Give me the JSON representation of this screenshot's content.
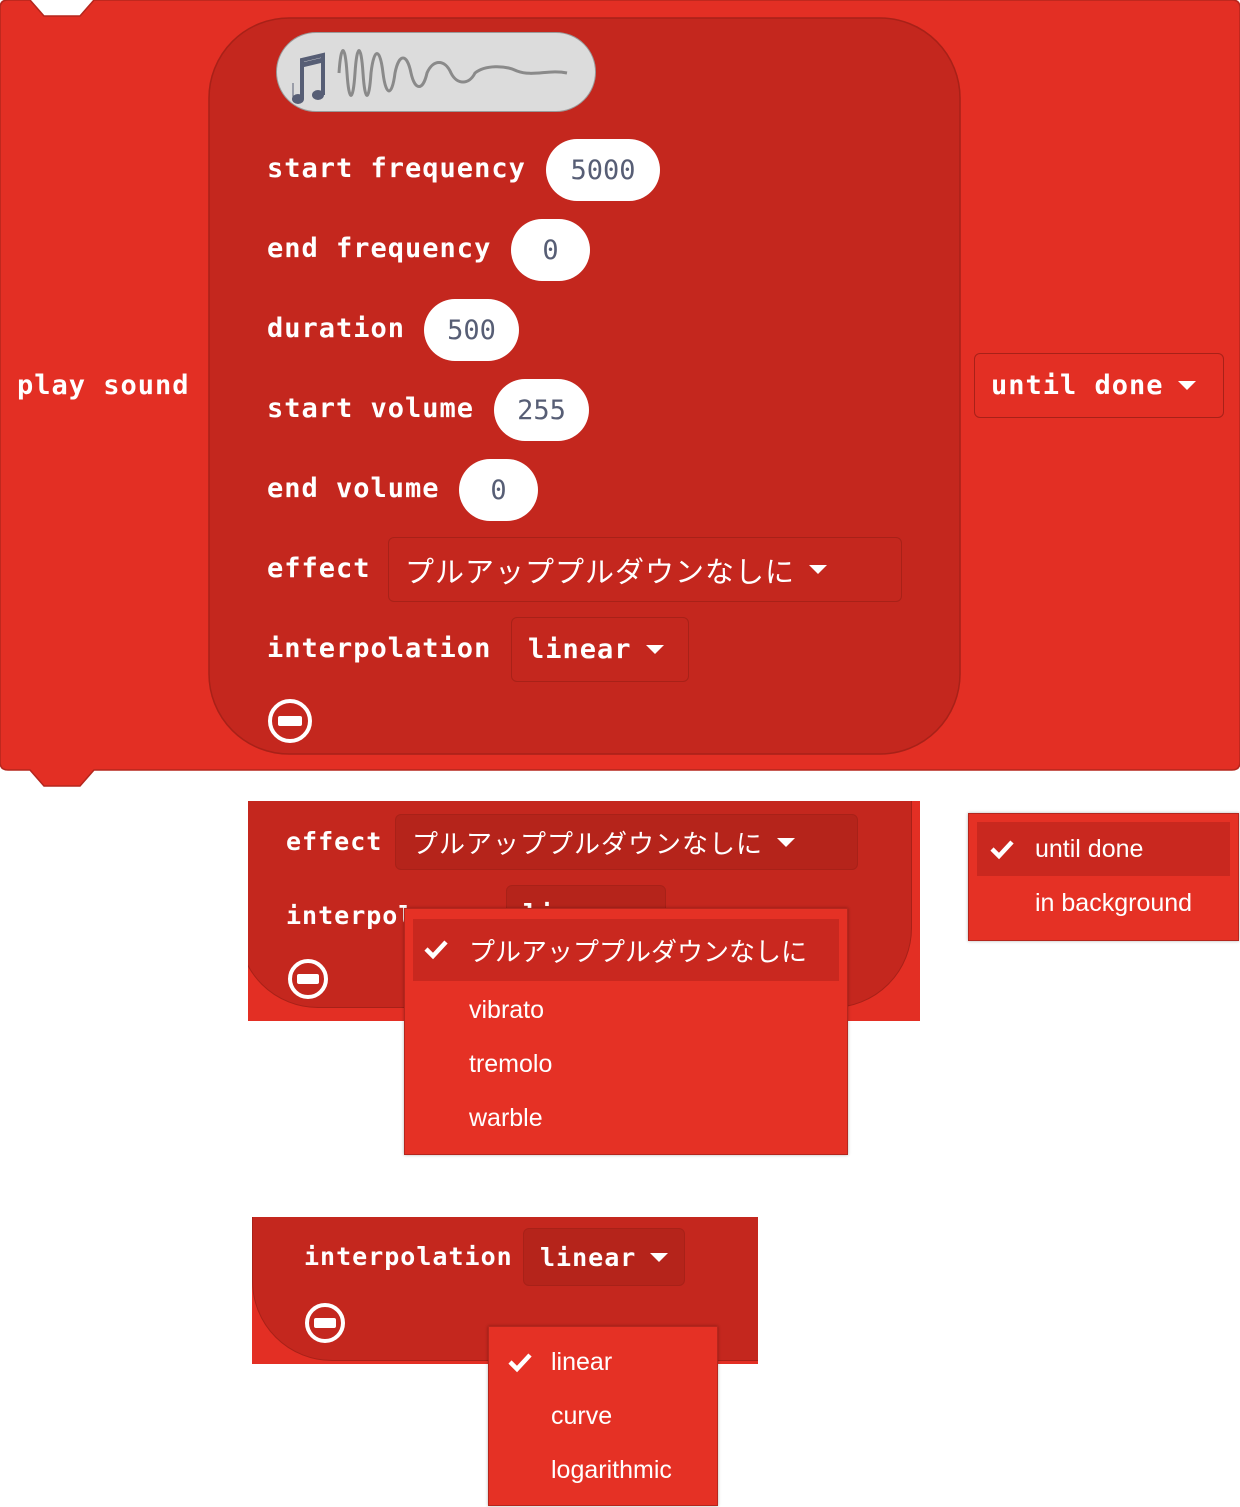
{
  "block": {
    "label": "play sound",
    "fields": [
      {
        "label": "start frequency",
        "value": "5000"
      },
      {
        "label": "end frequency",
        "value": "0"
      },
      {
        "label": "duration",
        "value": "500"
      },
      {
        "label": "start volume",
        "value": "255"
      },
      {
        "label": "end volume",
        "value": "0"
      }
    ],
    "effect_label": "effect",
    "effect_value": "プルアッププルダウンなしに",
    "interpolation_label": "interpolation",
    "interpolation_value": "linear",
    "mode_value": "until done"
  },
  "effect_crop": {
    "effect_label": "effect",
    "effect_value": "プルアッププルダウンなしに",
    "interpolation_label": "interpol",
    "interpolation_value": "linear"
  },
  "effect_menu": {
    "items": [
      "プルアッププルダウンなしに",
      "vibrato",
      "tremolo",
      "warble"
    ],
    "selected": 0
  },
  "mode_menu": {
    "items": [
      "until done",
      "in background"
    ],
    "selected": 0
  },
  "interp_crop": {
    "interpolation_label": "interpolation",
    "interpolation_value": "linear"
  },
  "interp_menu": {
    "items": [
      "linear",
      "curve",
      "logarithmic"
    ],
    "selected": 0
  },
  "colors": {
    "block": "#e32f24",
    "inner": "#c4271e",
    "border": "#a82118",
    "field_text": "#575e75"
  },
  "icons": [
    "music-note-icon",
    "sound-wave-icon",
    "remove-input-icon",
    "dropdown-caret-icon",
    "checkmark-icon"
  ]
}
